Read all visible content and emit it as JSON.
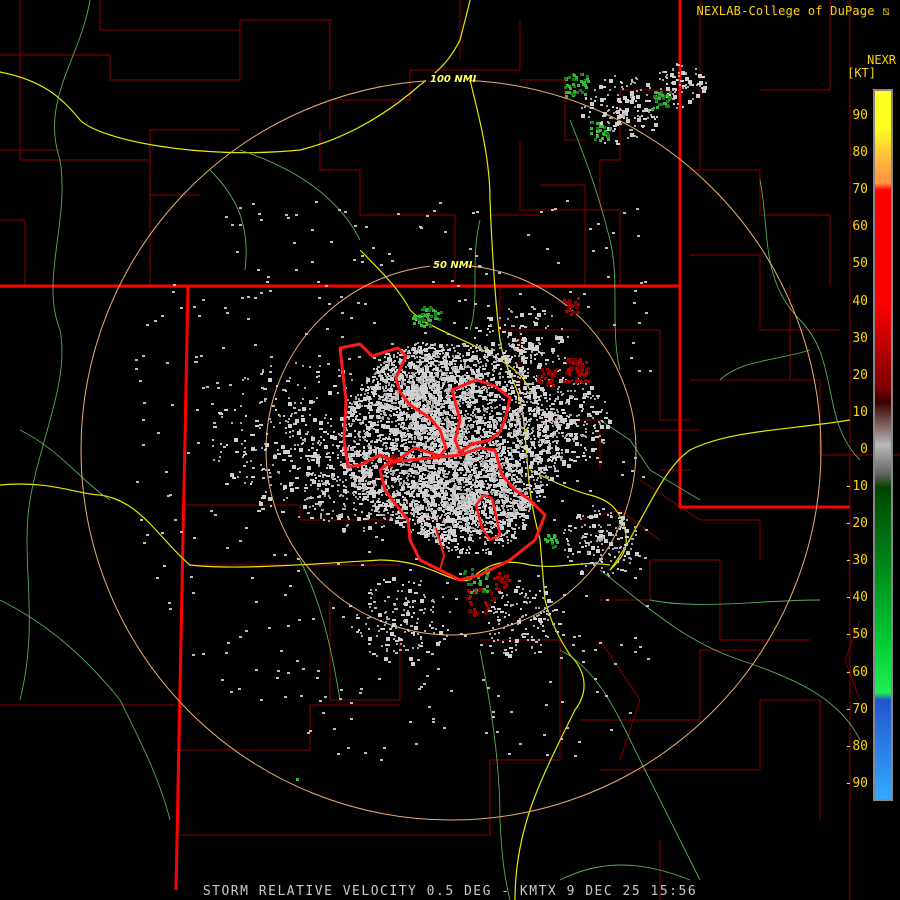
{
  "header": {
    "credit": "NEXLAB-College of DuPage",
    "product_code": "NEXR",
    "unit": "[KT]"
  },
  "legend": {
    "ticks": [
      "90",
      "80",
      "70",
      "60",
      "50",
      "40",
      "30",
      "20",
      "10",
      "0",
      "-10",
      "-20",
      "-30",
      "-40",
      "-50",
      "-60",
      "-70",
      "-80",
      "-90"
    ],
    "colors": {
      "top": "#ffff22",
      "orange": "#ff9944",
      "red": "#ff0000",
      "dark_red": "#7a0000",
      "gray": "#b8b8b8",
      "dark_green": "#004400",
      "green": "#00cc33",
      "blue": "#2255cc",
      "light_blue": "#33aaff"
    }
  },
  "range_rings": [
    {
      "label": "100 NMI"
    },
    {
      "label": "50 NMI"
    }
  ],
  "footer": {
    "caption": "STORM RELATIVE VELOCITY 0.5 DEG - KMTX 9 DEC 25 15:56"
  }
}
